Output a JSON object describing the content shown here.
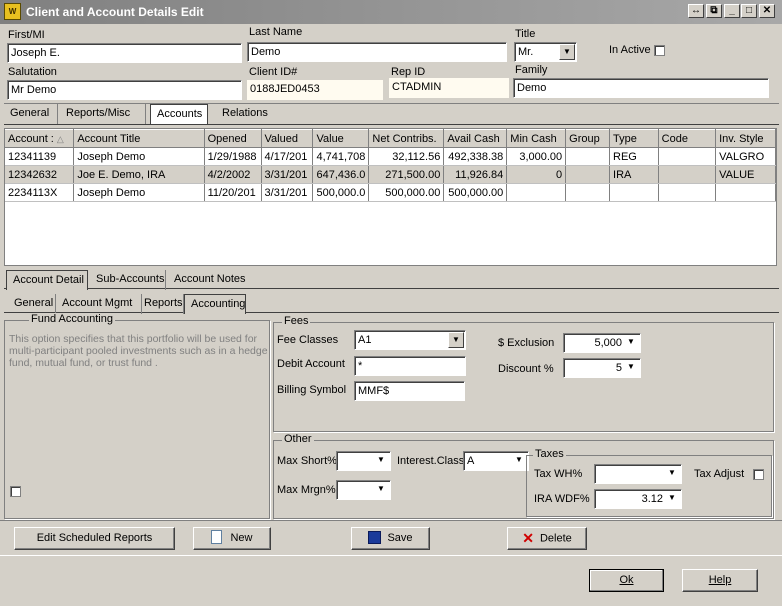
{
  "window": {
    "title": "Client and Account Details Edit",
    "app_icon": "app-icon"
  },
  "client": {
    "first_mi_label": "First/MI",
    "first_mi": "Joseph E.",
    "last_name_label": "Last Name",
    "last_name": "Demo",
    "title_label": "Title",
    "title": "Mr.",
    "in_active_label": "In Active",
    "salutation_label": "Salutation",
    "salutation": "Mr Demo",
    "client_id_label": "Client ID#",
    "client_id": "0188JED0453",
    "rep_id_label": "Rep ID",
    "rep_id": "CTADMIN",
    "family_label": "Family",
    "family": "Demo"
  },
  "main_tabs": [
    "General",
    "Reports/Misc",
    "Accounts",
    "Relations"
  ],
  "accounts_table": {
    "columns": [
      "Account :",
      "Account Title",
      "Opened",
      "Valued",
      "Value",
      "Net Contribs.",
      "Avail Cash",
      "Min Cash",
      "Group",
      "Type",
      "Code",
      "Inv. Style"
    ],
    "rows": [
      [
        "12341139",
        "Joseph Demo",
        "1/29/1988",
        "4/17/201",
        "4,741,708",
        "32,112.56",
        "492,338.38",
        "3,000.00",
        "",
        "REG",
        "",
        "VALGRO"
      ],
      [
        "12342632",
        "Joe E. Demo, IRA",
        "4/2/2002",
        "3/31/201",
        "647,436.0",
        "271,500.00",
        "11,926.84",
        "0",
        "",
        "IRA",
        "",
        "VALUE"
      ],
      [
        "2234113X",
        "Joseph Demo",
        "11/20/201",
        "3/31/201",
        "500,000.0",
        "500,000.00",
        "500,000.00",
        "",
        "",
        "",
        "",
        ""
      ]
    ]
  },
  "detail_tabs": [
    "Account Detail",
    "Sub-Accounts",
    "Account Notes"
  ],
  "sub_tabs": [
    "General",
    "Account Mgmt",
    "Reports",
    "Accounting"
  ],
  "fund_accounting": {
    "title": "Fund Accounting",
    "description": "This option specifies that this portfolio will be used for multi-participant pooled investments such as in a hedge fund, mutual fund, or trust fund ."
  },
  "fees": {
    "title": "Fees",
    "fee_classes_label": "Fee Classes",
    "fee_classes": "A1",
    "debit_account_label": "Debit Account",
    "debit_account": "*",
    "billing_symbol_label": "Billing Symbol",
    "billing_symbol": "MMF$",
    "exclusion_label": "$ Exclusion",
    "exclusion": "5,000",
    "discount_label": "Discount %",
    "discount": "5"
  },
  "other": {
    "title": "Other",
    "max_short_label": "Max Short%",
    "max_short": "",
    "interest_class_label": "Interest.Class",
    "interest_class": "A",
    "max_mrgn_label": "Max Mrgn%",
    "max_mrgn": ""
  },
  "taxes": {
    "title": "Taxes",
    "tax_wh_label": "Tax WH%",
    "tax_wh": "",
    "tax_adjust_label": "Tax Adjust",
    "ira_wdf_label": "IRA WDF%",
    "ira_wdf": "3.12"
  },
  "buttons": {
    "edit_scheduled_reports": "Edit Scheduled Reports",
    "new": "New",
    "save": "Save",
    "delete": "Delete",
    "ok": "Ok",
    "help": "Help"
  },
  "colors": {
    "titlebar": "#a0a0a0",
    "delete_icon": "#d00000",
    "save_icon": "#1a3a9a"
  }
}
